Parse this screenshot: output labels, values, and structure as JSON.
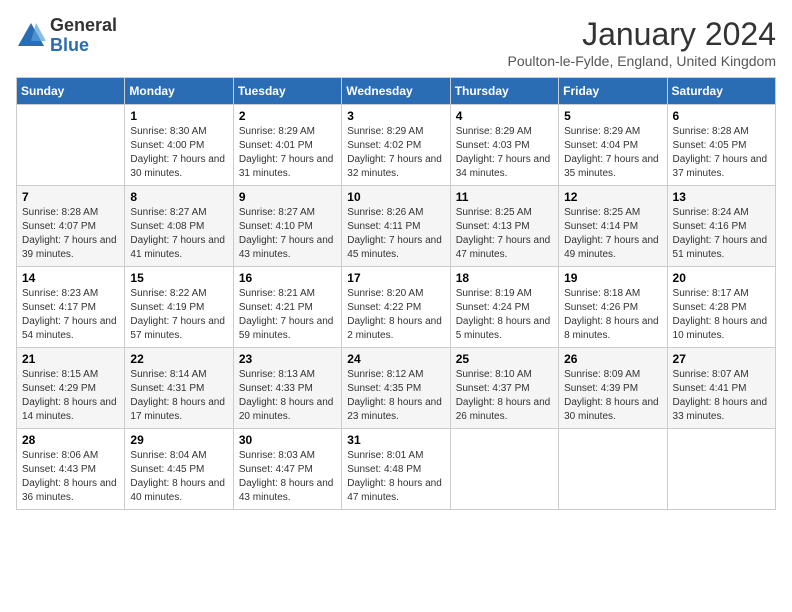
{
  "logo": {
    "general": "General",
    "blue": "Blue"
  },
  "title": "January 2024",
  "subtitle": "Poulton-le-Fylde, England, United Kingdom",
  "days_of_week": [
    "Sunday",
    "Monday",
    "Tuesday",
    "Wednesday",
    "Thursday",
    "Friday",
    "Saturday"
  ],
  "weeks": [
    [
      {
        "num": "",
        "sunrise": "",
        "sunset": "",
        "daylight": ""
      },
      {
        "num": "1",
        "sunrise": "Sunrise: 8:30 AM",
        "sunset": "Sunset: 4:00 PM",
        "daylight": "Daylight: 7 hours and 30 minutes."
      },
      {
        "num": "2",
        "sunrise": "Sunrise: 8:29 AM",
        "sunset": "Sunset: 4:01 PM",
        "daylight": "Daylight: 7 hours and 31 minutes."
      },
      {
        "num": "3",
        "sunrise": "Sunrise: 8:29 AM",
        "sunset": "Sunset: 4:02 PM",
        "daylight": "Daylight: 7 hours and 32 minutes."
      },
      {
        "num": "4",
        "sunrise": "Sunrise: 8:29 AM",
        "sunset": "Sunset: 4:03 PM",
        "daylight": "Daylight: 7 hours and 34 minutes."
      },
      {
        "num": "5",
        "sunrise": "Sunrise: 8:29 AM",
        "sunset": "Sunset: 4:04 PM",
        "daylight": "Daylight: 7 hours and 35 minutes."
      },
      {
        "num": "6",
        "sunrise": "Sunrise: 8:28 AM",
        "sunset": "Sunset: 4:05 PM",
        "daylight": "Daylight: 7 hours and 37 minutes."
      }
    ],
    [
      {
        "num": "7",
        "sunrise": "Sunrise: 8:28 AM",
        "sunset": "Sunset: 4:07 PM",
        "daylight": "Daylight: 7 hours and 39 minutes."
      },
      {
        "num": "8",
        "sunrise": "Sunrise: 8:27 AM",
        "sunset": "Sunset: 4:08 PM",
        "daylight": "Daylight: 7 hours and 41 minutes."
      },
      {
        "num": "9",
        "sunrise": "Sunrise: 8:27 AM",
        "sunset": "Sunset: 4:10 PM",
        "daylight": "Daylight: 7 hours and 43 minutes."
      },
      {
        "num": "10",
        "sunrise": "Sunrise: 8:26 AM",
        "sunset": "Sunset: 4:11 PM",
        "daylight": "Daylight: 7 hours and 45 minutes."
      },
      {
        "num": "11",
        "sunrise": "Sunrise: 8:25 AM",
        "sunset": "Sunset: 4:13 PM",
        "daylight": "Daylight: 7 hours and 47 minutes."
      },
      {
        "num": "12",
        "sunrise": "Sunrise: 8:25 AM",
        "sunset": "Sunset: 4:14 PM",
        "daylight": "Daylight: 7 hours and 49 minutes."
      },
      {
        "num": "13",
        "sunrise": "Sunrise: 8:24 AM",
        "sunset": "Sunset: 4:16 PM",
        "daylight": "Daylight: 7 hours and 51 minutes."
      }
    ],
    [
      {
        "num": "14",
        "sunrise": "Sunrise: 8:23 AM",
        "sunset": "Sunset: 4:17 PM",
        "daylight": "Daylight: 7 hours and 54 minutes."
      },
      {
        "num": "15",
        "sunrise": "Sunrise: 8:22 AM",
        "sunset": "Sunset: 4:19 PM",
        "daylight": "Daylight: 7 hours and 57 minutes."
      },
      {
        "num": "16",
        "sunrise": "Sunrise: 8:21 AM",
        "sunset": "Sunset: 4:21 PM",
        "daylight": "Daylight: 7 hours and 59 minutes."
      },
      {
        "num": "17",
        "sunrise": "Sunrise: 8:20 AM",
        "sunset": "Sunset: 4:22 PM",
        "daylight": "Daylight: 8 hours and 2 minutes."
      },
      {
        "num": "18",
        "sunrise": "Sunrise: 8:19 AM",
        "sunset": "Sunset: 4:24 PM",
        "daylight": "Daylight: 8 hours and 5 minutes."
      },
      {
        "num": "19",
        "sunrise": "Sunrise: 8:18 AM",
        "sunset": "Sunset: 4:26 PM",
        "daylight": "Daylight: 8 hours and 8 minutes."
      },
      {
        "num": "20",
        "sunrise": "Sunrise: 8:17 AM",
        "sunset": "Sunset: 4:28 PM",
        "daylight": "Daylight: 8 hours and 10 minutes."
      }
    ],
    [
      {
        "num": "21",
        "sunrise": "Sunrise: 8:15 AM",
        "sunset": "Sunset: 4:29 PM",
        "daylight": "Daylight: 8 hours and 14 minutes."
      },
      {
        "num": "22",
        "sunrise": "Sunrise: 8:14 AM",
        "sunset": "Sunset: 4:31 PM",
        "daylight": "Daylight: 8 hours and 17 minutes."
      },
      {
        "num": "23",
        "sunrise": "Sunrise: 8:13 AM",
        "sunset": "Sunset: 4:33 PM",
        "daylight": "Daylight: 8 hours and 20 minutes."
      },
      {
        "num": "24",
        "sunrise": "Sunrise: 8:12 AM",
        "sunset": "Sunset: 4:35 PM",
        "daylight": "Daylight: 8 hours and 23 minutes."
      },
      {
        "num": "25",
        "sunrise": "Sunrise: 8:10 AM",
        "sunset": "Sunset: 4:37 PM",
        "daylight": "Daylight: 8 hours and 26 minutes."
      },
      {
        "num": "26",
        "sunrise": "Sunrise: 8:09 AM",
        "sunset": "Sunset: 4:39 PM",
        "daylight": "Daylight: 8 hours and 30 minutes."
      },
      {
        "num": "27",
        "sunrise": "Sunrise: 8:07 AM",
        "sunset": "Sunset: 4:41 PM",
        "daylight": "Daylight: 8 hours and 33 minutes."
      }
    ],
    [
      {
        "num": "28",
        "sunrise": "Sunrise: 8:06 AM",
        "sunset": "Sunset: 4:43 PM",
        "daylight": "Daylight: 8 hours and 36 minutes."
      },
      {
        "num": "29",
        "sunrise": "Sunrise: 8:04 AM",
        "sunset": "Sunset: 4:45 PM",
        "daylight": "Daylight: 8 hours and 40 minutes."
      },
      {
        "num": "30",
        "sunrise": "Sunrise: 8:03 AM",
        "sunset": "Sunset: 4:47 PM",
        "daylight": "Daylight: 8 hours and 43 minutes."
      },
      {
        "num": "31",
        "sunrise": "Sunrise: 8:01 AM",
        "sunset": "Sunset: 4:48 PM",
        "daylight": "Daylight: 8 hours and 47 minutes."
      },
      {
        "num": "",
        "sunrise": "",
        "sunset": "",
        "daylight": ""
      },
      {
        "num": "",
        "sunrise": "",
        "sunset": "",
        "daylight": ""
      },
      {
        "num": "",
        "sunrise": "",
        "sunset": "",
        "daylight": ""
      }
    ]
  ]
}
